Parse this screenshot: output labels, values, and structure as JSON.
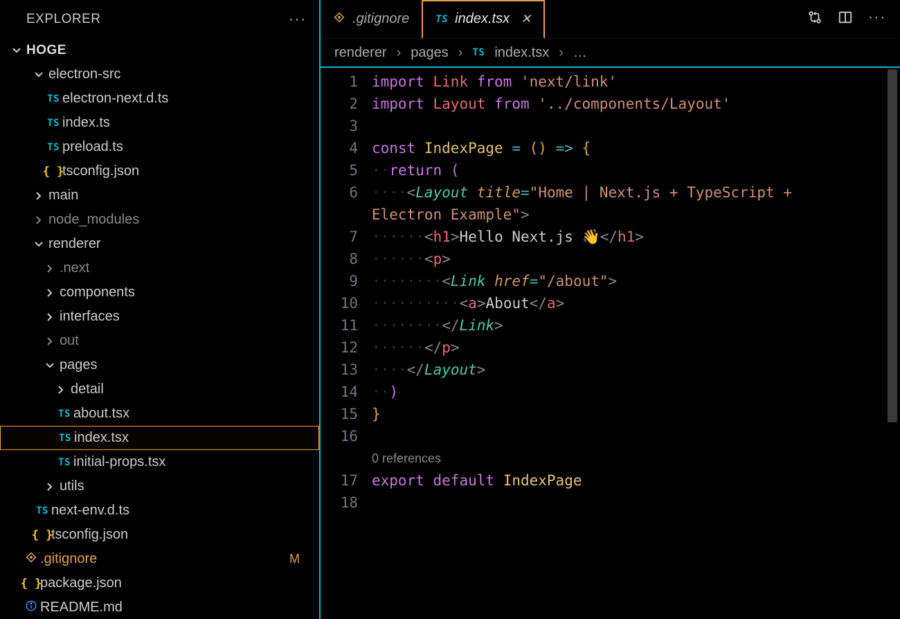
{
  "sidebar": {
    "title": "EXPLORER",
    "root": "HOGE",
    "items": [
      {
        "depth": 1,
        "kind": "folder",
        "open": true,
        "label": "electron-src"
      },
      {
        "depth": 2,
        "kind": "ts",
        "label": "electron-next.d.ts"
      },
      {
        "depth": 2,
        "kind": "ts",
        "label": "index.ts"
      },
      {
        "depth": 2,
        "kind": "ts",
        "label": "preload.ts"
      },
      {
        "depth": 2,
        "kind": "json",
        "label": "tsconfig.json"
      },
      {
        "depth": 1,
        "kind": "folder",
        "open": false,
        "label": "main"
      },
      {
        "depth": 1,
        "kind": "folder",
        "open": false,
        "label": "node_modules",
        "muted": true
      },
      {
        "depth": 1,
        "kind": "folder",
        "open": true,
        "label": "renderer"
      },
      {
        "depth": 2,
        "kind": "folder",
        "open": false,
        "label": ".next",
        "muted": true
      },
      {
        "depth": 2,
        "kind": "folder",
        "open": false,
        "label": "components"
      },
      {
        "depth": 2,
        "kind": "folder",
        "open": false,
        "label": "interfaces"
      },
      {
        "depth": 2,
        "kind": "folder",
        "open": false,
        "label": "out",
        "muted": true
      },
      {
        "depth": 2,
        "kind": "folder",
        "open": true,
        "label": "pages"
      },
      {
        "depth": 3,
        "kind": "folder",
        "open": false,
        "label": "detail"
      },
      {
        "depth": 3,
        "kind": "ts",
        "label": "about.tsx"
      },
      {
        "depth": 3,
        "kind": "ts",
        "label": "index.tsx",
        "selected": true
      },
      {
        "depth": 3,
        "kind": "ts",
        "label": "initial-props.tsx"
      },
      {
        "depth": 2,
        "kind": "folder",
        "open": false,
        "label": "utils"
      },
      {
        "depth": 1,
        "kind": "ts",
        "label": "next-env.d.ts"
      },
      {
        "depth": 1,
        "kind": "json",
        "label": "tsconfig.json"
      },
      {
        "depth": 0,
        "kind": "gitignore",
        "label": ".gitignore",
        "git": "M"
      },
      {
        "depth": 0,
        "kind": "json",
        "label": "package.json"
      },
      {
        "depth": 0,
        "kind": "readme",
        "label": "README.md"
      }
    ]
  },
  "tabs": [
    {
      "icon": "gitignore",
      "label": ".gitignore",
      "active": false,
      "close": false
    },
    {
      "icon": "ts",
      "label": "index.tsx",
      "active": true,
      "close": true
    }
  ],
  "breadcrumb": {
    "parts": [
      "renderer",
      "pages"
    ],
    "fileIcon": "TS",
    "file": "index.tsx",
    "trailing": "…"
  },
  "codeLens": "0 references",
  "code": {
    "lineCount": 18,
    "lines": [
      {
        "n": 1,
        "tokens": [
          [
            "kw",
            "import"
          ],
          [
            "sp",
            " "
          ],
          [
            "var",
            "Link"
          ],
          [
            "sp",
            " "
          ],
          [
            "kw",
            "from"
          ],
          [
            "sp",
            " "
          ],
          [
            "str",
            "'next/link'"
          ]
        ]
      },
      {
        "n": 2,
        "tokens": [
          [
            "kw",
            "import"
          ],
          [
            "sp",
            " "
          ],
          [
            "var",
            "Layout"
          ],
          [
            "sp",
            " "
          ],
          [
            "kw",
            "from"
          ],
          [
            "sp",
            " "
          ],
          [
            "str",
            "'../components/Layout'"
          ]
        ]
      },
      {
        "n": 3,
        "tokens": []
      },
      {
        "n": 4,
        "tokens": [
          [
            "kw",
            "const"
          ],
          [
            "sp",
            " "
          ],
          [
            "fn",
            "IndexPage"
          ],
          [
            "sp",
            " "
          ],
          [
            "op",
            "="
          ],
          [
            "sp",
            " "
          ],
          [
            "brace",
            "()"
          ],
          [
            "sp",
            " "
          ],
          [
            "op",
            "=>"
          ],
          [
            "sp",
            " "
          ],
          [
            "brace",
            "{"
          ]
        ]
      },
      {
        "n": 5,
        "tokens": [
          [
            "ind",
            "··"
          ],
          [
            "kw",
            "return"
          ],
          [
            "sp",
            " "
          ],
          [
            "paren2",
            "("
          ]
        ]
      },
      {
        "n": 6,
        "tokens": [
          [
            "ind",
            "····"
          ],
          [
            "tag",
            "<"
          ],
          [
            "type",
            "Layout"
          ],
          [
            "sp",
            " "
          ],
          [
            "attr",
            "title"
          ],
          [
            "op",
            "="
          ],
          [
            "str",
            "\"Home | Next.js + TypeScript + "
          ]
        ],
        "wrap": true
      },
      {
        "n": 0,
        "tokens": [
          [
            "str",
            "Electron Example\""
          ],
          [
            "tag",
            ">"
          ]
        ]
      },
      {
        "n": 7,
        "tokens": [
          [
            "ind",
            "······"
          ],
          [
            "tag",
            "<"
          ],
          [
            "var",
            "h1"
          ],
          [
            "tag",
            ">"
          ],
          [
            "text",
            "Hello Next.js 👋"
          ],
          [
            "tag",
            "</"
          ],
          [
            "var",
            "h1"
          ],
          [
            "tag",
            ">"
          ]
        ]
      },
      {
        "n": 8,
        "tokens": [
          [
            "ind",
            "······"
          ],
          [
            "tag",
            "<"
          ],
          [
            "var",
            "p"
          ],
          [
            "tag",
            ">"
          ]
        ]
      },
      {
        "n": 9,
        "tokens": [
          [
            "ind",
            "········"
          ],
          [
            "tag",
            "<"
          ],
          [
            "type",
            "Link"
          ],
          [
            "sp",
            " "
          ],
          [
            "attr",
            "href"
          ],
          [
            "op",
            "="
          ],
          [
            "str",
            "\"/about\""
          ],
          [
            "tag",
            ">"
          ]
        ]
      },
      {
        "n": 10,
        "tokens": [
          [
            "ind",
            "··········"
          ],
          [
            "tag",
            "<"
          ],
          [
            "var",
            "a"
          ],
          [
            "tag",
            ">"
          ],
          [
            "text",
            "About"
          ],
          [
            "tag",
            "</"
          ],
          [
            "var",
            "a"
          ],
          [
            "tag",
            ">"
          ]
        ]
      },
      {
        "n": 11,
        "tokens": [
          [
            "ind",
            "········"
          ],
          [
            "tag",
            "</"
          ],
          [
            "type",
            "Link"
          ],
          [
            "tag",
            ">"
          ]
        ]
      },
      {
        "n": 12,
        "tokens": [
          [
            "ind",
            "······"
          ],
          [
            "tag",
            "</"
          ],
          [
            "var",
            "p"
          ],
          [
            "tag",
            ">"
          ]
        ]
      },
      {
        "n": 13,
        "tokens": [
          [
            "ind",
            "····"
          ],
          [
            "tag",
            "</"
          ],
          [
            "type",
            "Layout"
          ],
          [
            "tag",
            ">"
          ]
        ]
      },
      {
        "n": 14,
        "tokens": [
          [
            "ind",
            "··"
          ],
          [
            "paren2",
            ")"
          ]
        ]
      },
      {
        "n": 15,
        "tokens": [
          [
            "brace",
            "}"
          ]
        ]
      },
      {
        "n": 16,
        "tokens": []
      },
      {
        "n": -1,
        "codelens": true
      },
      {
        "n": 17,
        "tokens": [
          [
            "kw",
            "export"
          ],
          [
            "sp",
            " "
          ],
          [
            "kw",
            "default"
          ],
          [
            "sp",
            " "
          ],
          [
            "fn",
            "IndexPage"
          ]
        ]
      },
      {
        "n": 18,
        "tokens": []
      }
    ]
  }
}
